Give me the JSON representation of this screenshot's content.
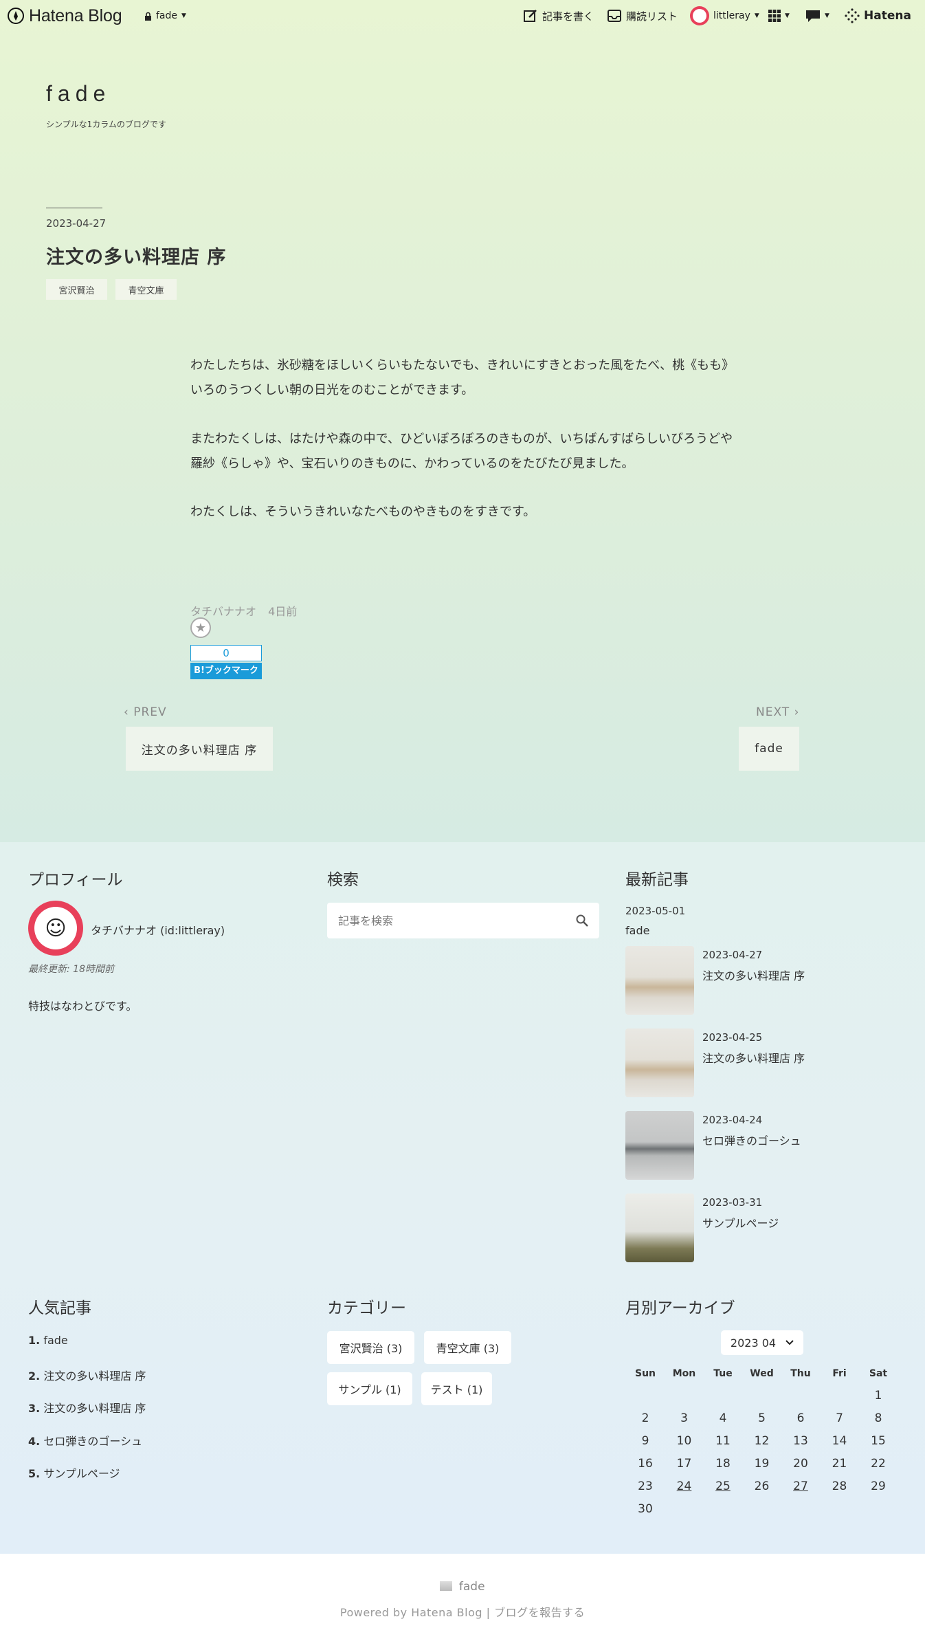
{
  "topbar": {
    "logo": "Hatena Blog",
    "blog_switch": "fade",
    "write": "記事を書く",
    "subscriptions": "購読リスト",
    "user": "littleray",
    "brand": "Hatena"
  },
  "header": {
    "title": "fade",
    "description": "シンプルな1カラムのブログです"
  },
  "entry": {
    "date": "2023-04-27",
    "title": "注文の多い料理店 序",
    "tags": [
      "宮沢賢治",
      "青空文庫"
    ],
    "paragraphs": [
      "わたしたちは、氷砂糖をほしいくらいもたないでも、きれいにすきとおった風をたべ、桃《もも》いろのうつくしい朝の日光をのむことができます。",
      "またわたくしは、はたけや森の中で、ひどいぼろぼろのきものが、いちばんすばらしいびろうどや羅紗《らしゃ》や、宝石いりのきものに、かわっているのをたびたび見ました。",
      "わたくしは、そういうきれいなたべものやきものをすきです。"
    ],
    "author": "タチバナナオ",
    "ago": "4日前",
    "bookmark_count": "0",
    "bookmark_label": "B!ブックマーク"
  },
  "pager": {
    "prev_label": "PREV",
    "prev_title": "注文の多い料理店 序",
    "next_label": "NEXT",
    "next_title": "fade"
  },
  "profile": {
    "heading": "プロフィール",
    "name": "タチバナナオ (id:littleray)",
    "updated": "最終更新: 18時間前",
    "bio": "特技はなわとびです。"
  },
  "search": {
    "heading": "検索",
    "placeholder": "記事を検索"
  },
  "recent": {
    "heading": "最新記事",
    "first_date": "2023-05-01",
    "first_title": "fade",
    "items": [
      {
        "date": "2023-04-27",
        "title": "注文の多い料理店 序"
      },
      {
        "date": "2023-04-25",
        "title": "注文の多い料理店 序"
      },
      {
        "date": "2023-04-24",
        "title": "セロ弾きのゴーシュ"
      },
      {
        "date": "2023-03-31",
        "title": "サンプルページ"
      }
    ]
  },
  "popular": {
    "heading": "人気記事",
    "items": [
      {
        "num": "1.",
        "title": "fade"
      },
      {
        "num": "2.",
        "title": "注文の多い料理店 序"
      },
      {
        "num": "3.",
        "title": "注文の多い料理店 序"
      },
      {
        "num": "4.",
        "title": "セロ弾きのゴーシュ"
      },
      {
        "num": "5.",
        "title": "サンプルページ"
      }
    ]
  },
  "categories": {
    "heading": "カテゴリー",
    "items": [
      "宮沢賢治 (3)",
      "青空文庫 (3)",
      "サンプル (1)",
      "テスト (1)"
    ]
  },
  "archive": {
    "heading": "月別アーカイブ",
    "selected": "2023 04",
    "weekdays": [
      "Sun",
      "Mon",
      "Tue",
      "Wed",
      "Thu",
      "Fri",
      "Sat"
    ],
    "first_weekday": 6,
    "days": 30,
    "linked_days": [
      24,
      25,
      27
    ]
  },
  "footer": {
    "blog": "fade",
    "powered": "Powered by Hatena Blog | ブログを報告する"
  }
}
